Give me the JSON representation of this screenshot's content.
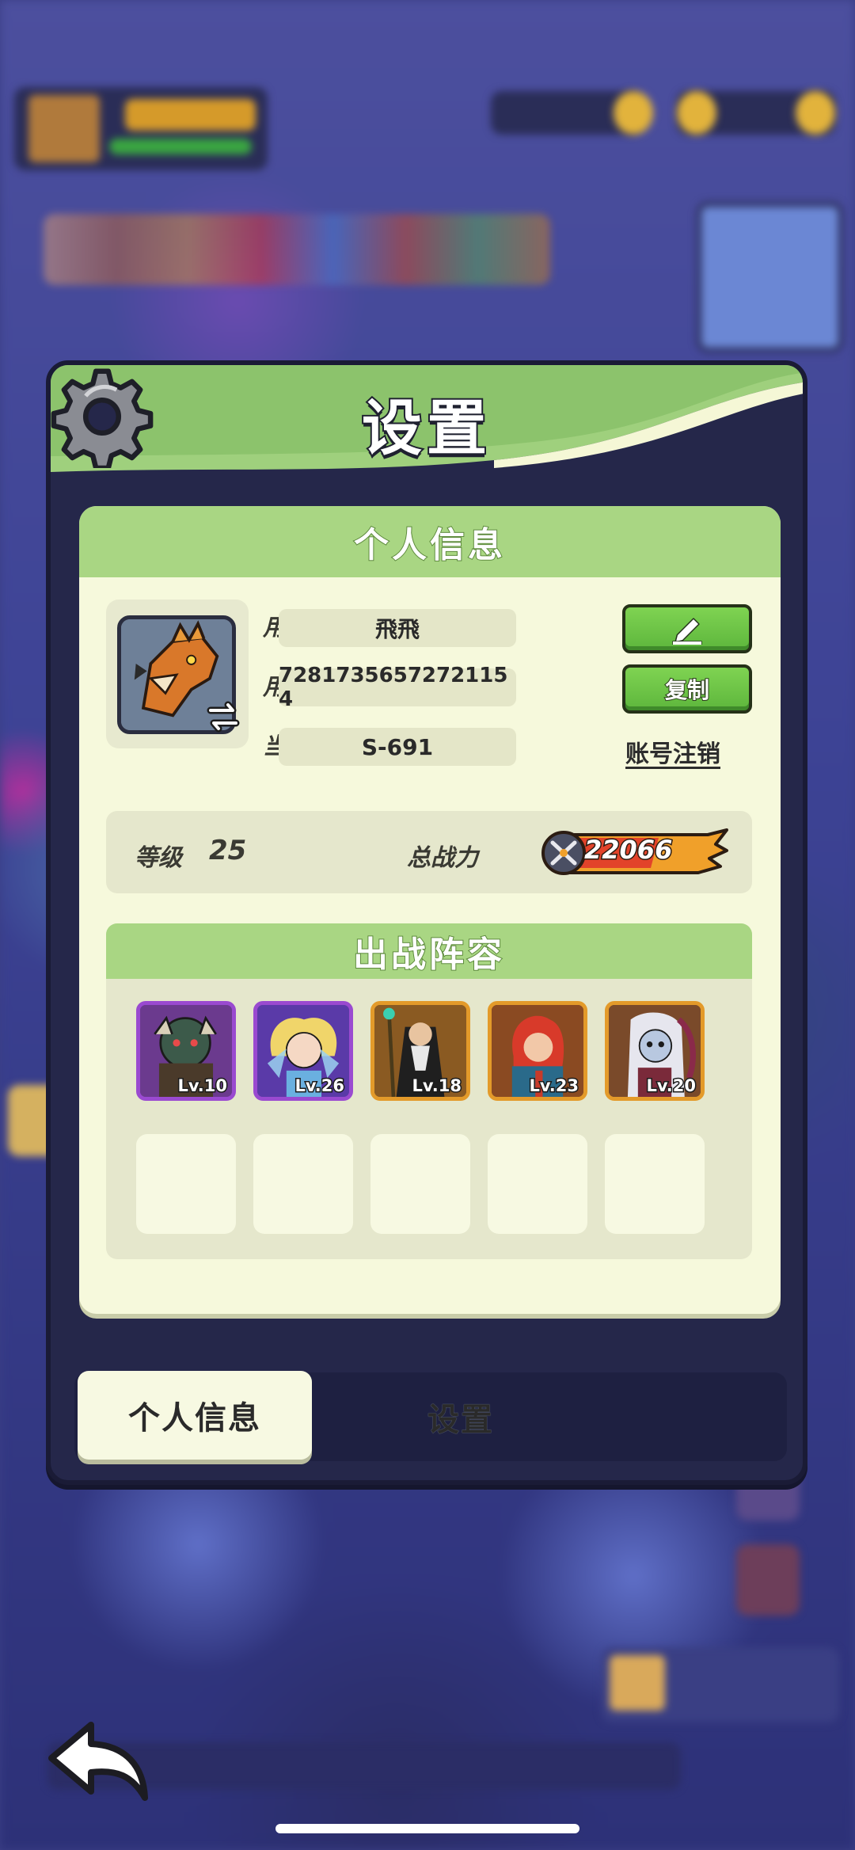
{
  "panel": {
    "title": "设置",
    "card_header": "个人信息"
  },
  "profile": {
    "nickname_label": "用户昵称",
    "nickname_value": "飛飛",
    "id_label": "用户 ID",
    "id_value": "7281735657272115 4",
    "server_label": "当前区服",
    "server_value": "S-691",
    "copy_button": "复制",
    "delete_account_link": "账号注销"
  },
  "stats": {
    "level_label": "等级",
    "level_value": "25",
    "power_label": "总战力",
    "power_value": "22066"
  },
  "lineup": {
    "title": "出战阵容",
    "heroes": [
      {
        "level": "Lv.10",
        "rarity": "purple"
      },
      {
        "level": "Lv.26",
        "rarity": "purple"
      },
      {
        "level": "Lv.18",
        "rarity": "gold"
      },
      {
        "level": "Lv.23",
        "rarity": "gold"
      },
      {
        "level": "Lv.20",
        "rarity": "gold"
      }
    ]
  },
  "tabs": {
    "active": "个人信息",
    "inactive": "设置"
  },
  "icons": {
    "gear": "gear-icon",
    "edit": "pencil-icon",
    "swap": "swap-icon",
    "power": "crossed-swords-icon",
    "back": "back-arrow-icon"
  },
  "colors": {
    "header_green": "#a9d683",
    "button_green": "#6cc447",
    "card_cream": "#f6f9dc",
    "panel_dark": "#25274a"
  }
}
